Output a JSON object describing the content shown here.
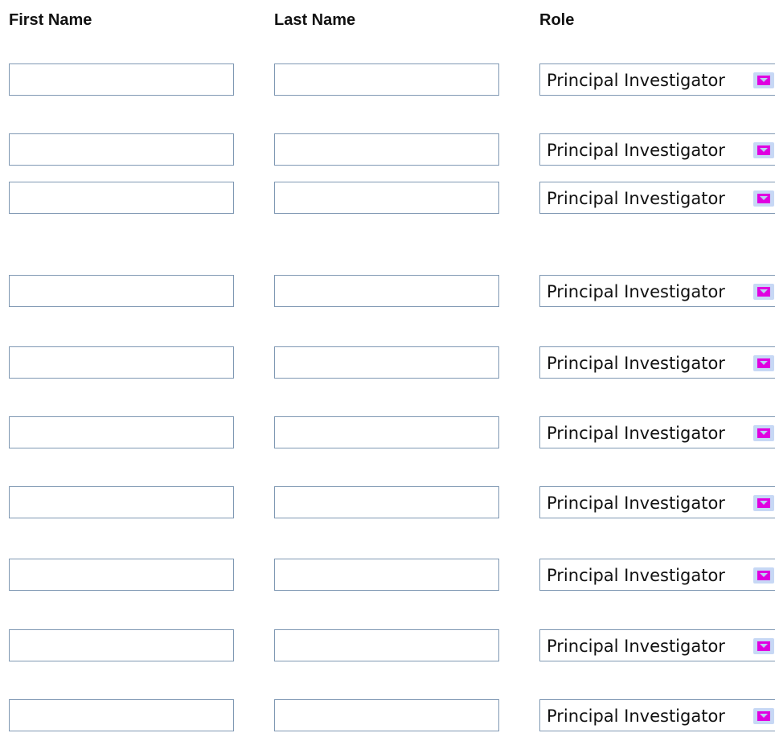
{
  "headers": {
    "first_name": "First Name",
    "last_name": "Last Name",
    "role": "Role"
  },
  "rows": [
    {
      "first_name": "",
      "last_name": "",
      "role": "Principal Investigator"
    },
    {
      "first_name": "",
      "last_name": "",
      "role": "Principal Investigator"
    },
    {
      "first_name": "",
      "last_name": "",
      "role": "Principal Investigator"
    },
    {
      "first_name": "",
      "last_name": "",
      "role": "Principal Investigator"
    },
    {
      "first_name": "",
      "last_name": "",
      "role": "Principal Investigator"
    },
    {
      "first_name": "",
      "last_name": "",
      "role": "Principal Investigator"
    },
    {
      "first_name": "",
      "last_name": "",
      "role": "Principal Investigator"
    },
    {
      "first_name": "",
      "last_name": "",
      "role": "Principal Investigator"
    },
    {
      "first_name": "",
      "last_name": "",
      "role": "Principal Investigator"
    },
    {
      "first_name": "",
      "last_name": "",
      "role": "Principal Investigator"
    }
  ],
  "icons": {
    "dropdown": "chevron-down-icon"
  },
  "colors": {
    "field_border": "#7f98b3",
    "dropdown_button_bg": "#c7d8f5",
    "dropdown_arrow": "#e000e0"
  }
}
